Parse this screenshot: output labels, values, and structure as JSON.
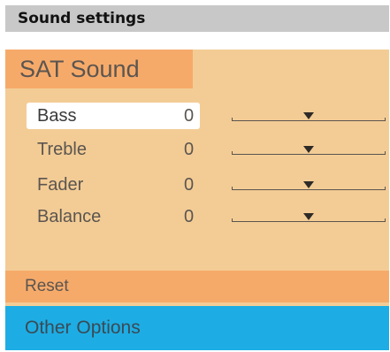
{
  "header": {
    "title": "Sound settings"
  },
  "panel": {
    "title": "SAT Sound",
    "rows": [
      {
        "label": "Bass",
        "value": "0",
        "level": 0.5
      },
      {
        "label": "Treble",
        "value": "0",
        "level": 0.5
      },
      {
        "label": "Fader",
        "value": "0",
        "level": 0.5
      },
      {
        "label": "Balance",
        "value": "0",
        "level": 0.5
      }
    ],
    "selected_row": "Bass",
    "reset_label": "Reset",
    "other_options_label": "Other Options"
  },
  "colors": {
    "panel_bg": "#f3cc95",
    "title_bg": "#f6aa6a",
    "reset_bg": "#f6aa6a",
    "other_options_bg": "#1dade4",
    "header_bg": "#c8c8c8",
    "selected_bg": "#ffffff"
  }
}
